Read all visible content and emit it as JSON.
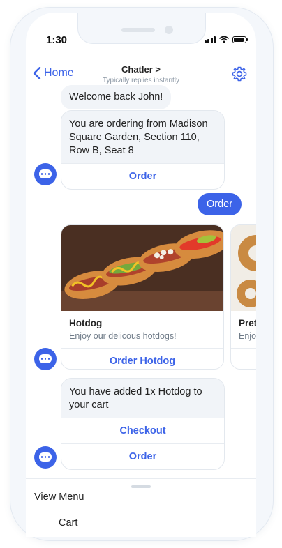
{
  "status_bar": {
    "time": "1:30"
  },
  "nav": {
    "back_label": "Home",
    "title": "Chatler",
    "title_chevron": ">",
    "subtitle": "Typically replies instantly"
  },
  "messages": {
    "welcome": "Welcome back John!",
    "ordering_from": "You are ordering from Madison Square Garden, Section 110, Row B, Seat 8",
    "order_button": "Order",
    "user_reply": "Order",
    "added_to_cart": "You have added 1x Hotdog to your cart",
    "checkout_button": "Checkout",
    "order_button_2": "Order"
  },
  "products": [
    {
      "name": "Hotdog",
      "description": "Enjoy our delicous hotdogs!",
      "button": "Order Hotdog"
    },
    {
      "name": "Pret",
      "description": "Enjo"
    }
  ],
  "bottom_menu": {
    "items": [
      "View Menu",
      "Cart"
    ]
  },
  "colors": {
    "accent": "#3c63e8",
    "bubble": "#f1f4f8"
  }
}
